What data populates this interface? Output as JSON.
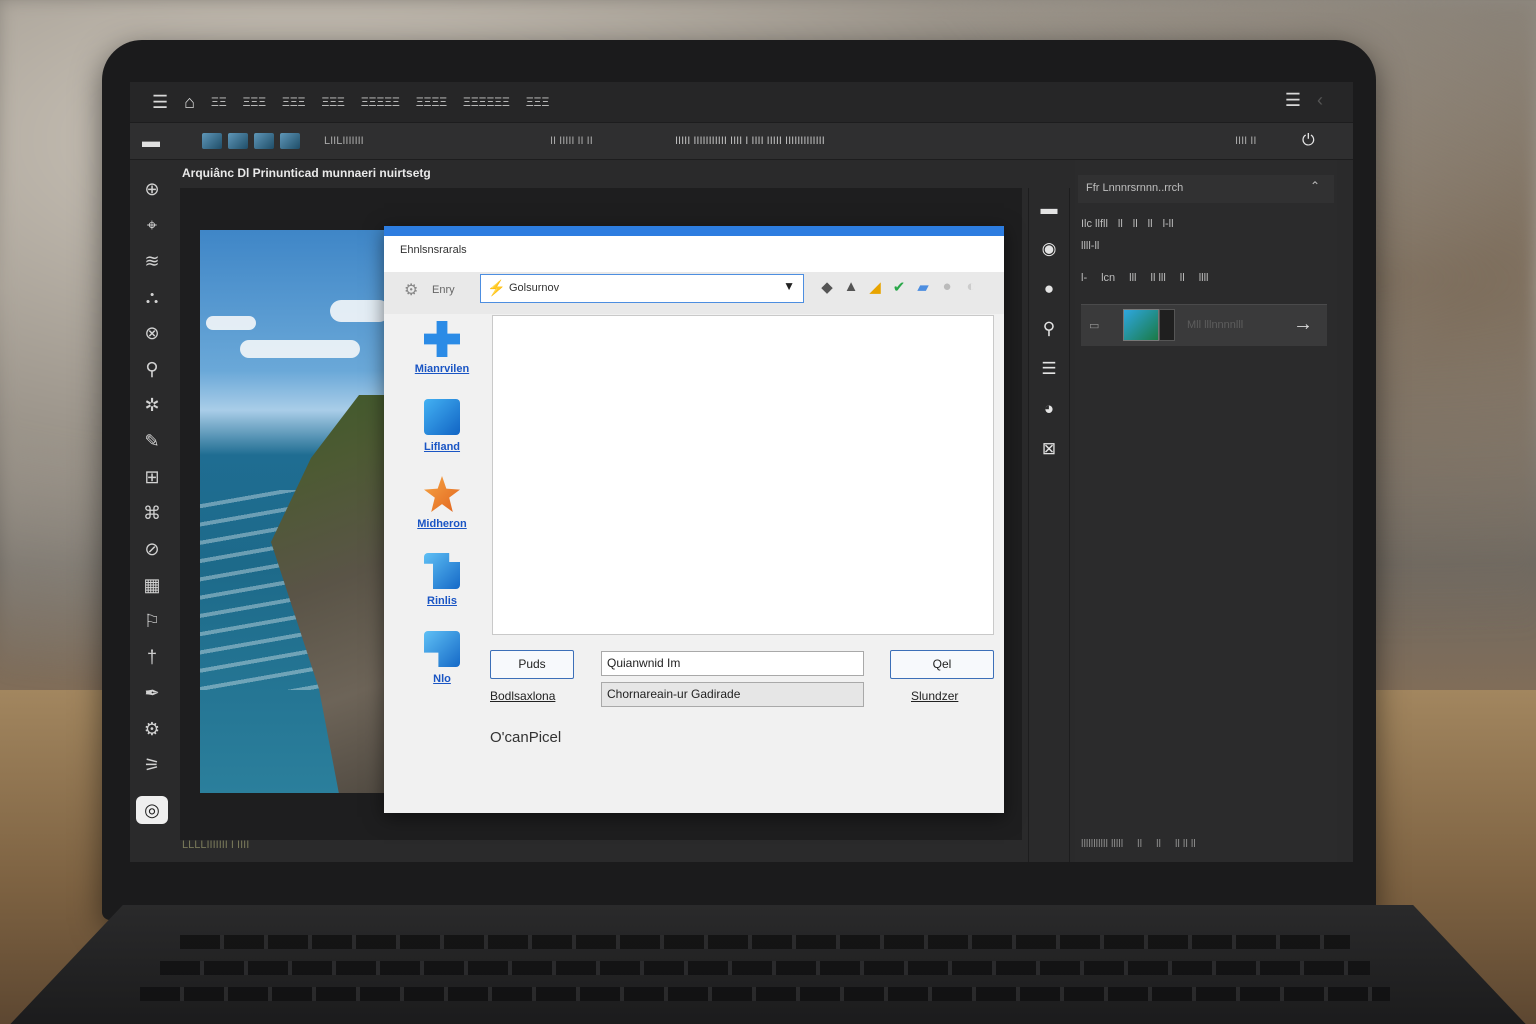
{
  "app": {
    "menu_items": [
      "ΞΞ",
      "ΞΞΞ",
      "ΞΞΞ",
      "ΞΞΞ",
      "ΞΞΞΞΞ",
      "ΞΞΞΞ",
      "ΞΞΞΞΞΞ",
      "ΞΞΞ"
    ],
    "doc_title": "Arquiânc Dl Prinunticad munnaeri nuirtsetg",
    "status_left": "LLLLIIIIIII I IIII"
  },
  "optbar": {
    "t1": "LIILIIIIIII",
    "t2": "II IIIII II II",
    "t3": "IIIII IIIIIIIIIII IIII I IIII IIIII IIIIIIIIIIIII",
    "t4": "IIII II"
  },
  "dialog": {
    "title": "Ehnlsnsrarals",
    "entry_label": "Enry",
    "lookin_value": "Golsurnov",
    "places": [
      {
        "label": "Mianrvilen",
        "color": "#2b8be6"
      },
      {
        "label": "Lifland",
        "color": "#1f86e0"
      },
      {
        "label": "Midheron",
        "color": "#f08a2a"
      },
      {
        "label": "Rinlis",
        "color": "#1e88e5"
      },
      {
        "label": "Nlo",
        "color": "#1e88e5"
      }
    ],
    "btn_left": "Puds",
    "field_name": "Quianwnid Im",
    "field_type": "Chornareain-ur Gadirade",
    "btn_right": "Qel",
    "link_left": "Bodlsaxlona",
    "link_right": "Slundzer",
    "footer": "O'canPicel"
  },
  "right_panel": {
    "title": "Ffr Lnnnrsrnnn..rrch",
    "row1": [
      "Ilc llfll",
      "ll",
      "ll",
      "ll",
      "l-ll"
    ],
    "row1b": "llll-ll",
    "row2": [
      "l-",
      "lcn",
      "lll",
      "ll lll",
      "ll",
      "llll"
    ],
    "layer_name": "Mll lllnnnnlll",
    "footer": [
      "lllllllllll lllll",
      "ll",
      "ll",
      "ll ll ll"
    ]
  },
  "colors": {
    "accent": "#2d7de0",
    "dark_bg": "#2a2a2b"
  }
}
